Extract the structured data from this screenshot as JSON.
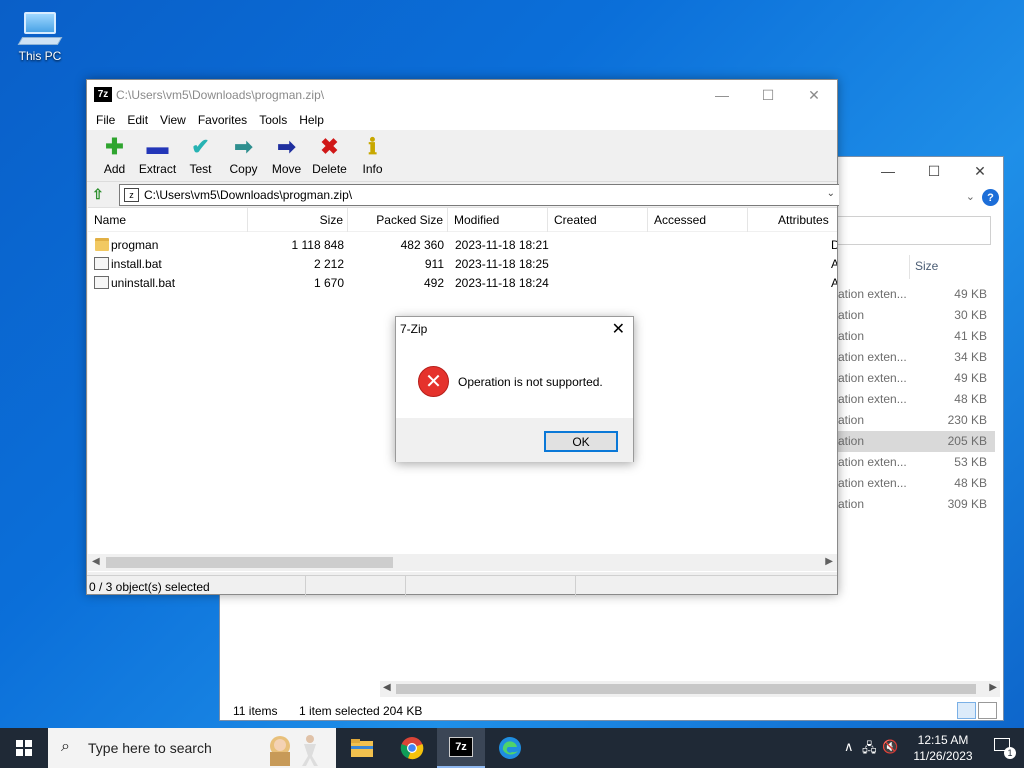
{
  "desktop": {
    "icon_label": "This PC"
  },
  "explorer": {
    "size_header": "Size",
    "rows": [
      {
        "type": "ation exten...",
        "size": "49 KB",
        "selected": false
      },
      {
        "type": "ation",
        "size": "30 KB",
        "selected": false
      },
      {
        "type": "ation",
        "size": "41 KB",
        "selected": false
      },
      {
        "type": "ation exten...",
        "size": "34 KB",
        "selected": false
      },
      {
        "type": "ation exten...",
        "size": "49 KB",
        "selected": false
      },
      {
        "type": "ation exten...",
        "size": "48 KB",
        "selected": false
      },
      {
        "type": "ation",
        "size": "230 KB",
        "selected": false
      },
      {
        "type": "ation",
        "size": "205 KB",
        "selected": true
      },
      {
        "type": "ation exten...",
        "size": "53 KB",
        "selected": false
      },
      {
        "type": "ation exten...",
        "size": "48 KB",
        "selected": false
      },
      {
        "type": "ation",
        "size": "309 KB",
        "selected": false
      }
    ],
    "status": {
      "items": "11 items",
      "selected": "1 item selected",
      "sel_size": "204 KB"
    }
  },
  "zip": {
    "title": "C:\\Users\\vm5\\Downloads\\progman.zip\\",
    "logo": "7z",
    "menu": [
      "File",
      "Edit",
      "View",
      "Favorites",
      "Tools",
      "Help"
    ],
    "toolbar": [
      {
        "label": "Add",
        "icon": "plus-icon",
        "glyph": "✚",
        "color": "#2fa52f"
      },
      {
        "label": "Extract",
        "icon": "minus-icon",
        "glyph": "▬",
        "color": "#2336b8"
      },
      {
        "label": "Test",
        "icon": "check-icon",
        "glyph": "✔",
        "color": "#27b3b3"
      },
      {
        "label": "Copy",
        "icon": "copy-arrow-icon",
        "glyph": "➡",
        "color": "#2f8f8f"
      },
      {
        "label": "Move",
        "icon": "move-arrow-icon",
        "glyph": "➡",
        "color": "#1f2f9f"
      },
      {
        "label": "Delete",
        "icon": "delete-x-icon",
        "glyph": "✖",
        "color": "#d01818"
      },
      {
        "label": "Info",
        "icon": "info-icon",
        "glyph": "ℹ",
        "color": "#c8a800"
      }
    ],
    "address": "C:\\Users\\vm5\\Downloads\\progman.zip\\",
    "columns": [
      "Name",
      "Size",
      "Packed Size",
      "Modified",
      "Created",
      "Accessed",
      "Attributes"
    ],
    "files": [
      {
        "name": "progman",
        "kind": "folder",
        "size": "1 118 848",
        "packed": "482 360",
        "modified": "2023-11-18 18:21",
        "attr": "D"
      },
      {
        "name": "install.bat",
        "kind": "file",
        "size": "2 212",
        "packed": "911",
        "modified": "2023-11-18 18:25",
        "attr": "A"
      },
      {
        "name": "uninstall.bat",
        "kind": "file",
        "size": "1 670",
        "packed": "492",
        "modified": "2023-11-18 18:24",
        "attr": "A"
      }
    ],
    "status_text": "0 / 3 object(s) selected"
  },
  "dialog": {
    "title": "7-Zip",
    "message": "Operation is not supported.",
    "ok_label": "OK"
  },
  "taskbar": {
    "search_placeholder": "Type here to search",
    "time": "12:15 AM",
    "date": "11/26/2023",
    "notification_count": "1",
    "active_app_label": "7z"
  }
}
